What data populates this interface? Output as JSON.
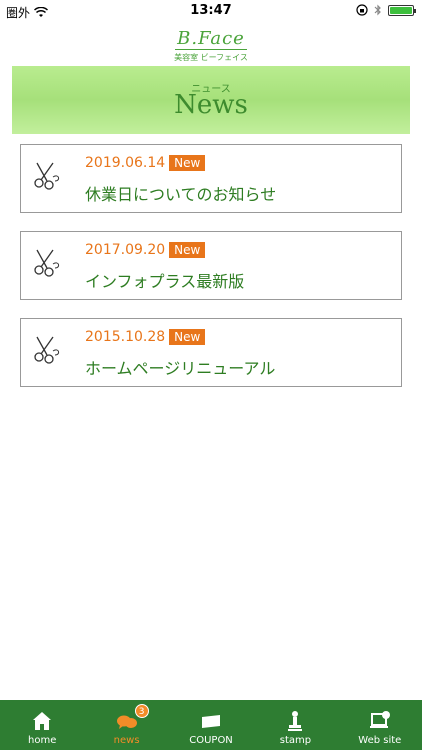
{
  "status_bar": {
    "carrier": "圏外",
    "time": "13:47",
    "battery_icon": "battery-full-icon",
    "wifi_icon": "wifi-icon",
    "bluetooth_icon": "bluetooth-icon",
    "lock_icon": "orientation-lock-icon"
  },
  "header": {
    "logo_text": "B.Face",
    "logo_sub": "美容室 ビーフェイス"
  },
  "banner": {
    "subtitle": "ニュース",
    "title": "News"
  },
  "news": [
    {
      "date": "2019.06.14",
      "badge": "New",
      "title": "休業日についてのお知らせ",
      "icon": "scissors-icon"
    },
    {
      "date": "2017.09.20",
      "badge": "New",
      "title": "インフォプラス最新版",
      "icon": "scissors-icon"
    },
    {
      "date": "2015.10.28",
      "badge": "New",
      "title": "ホームページリニューアル",
      "icon": "scissors-icon"
    }
  ],
  "tabs": [
    {
      "label": "home",
      "icon": "home-icon",
      "active": false
    },
    {
      "label": "news",
      "icon": "chat-bubbles-icon",
      "active": true,
      "badge": "3"
    },
    {
      "label": "COUPON",
      "icon": "coupon-ticket-icon",
      "active": false
    },
    {
      "label": "stamp",
      "icon": "stamp-icon",
      "active": false
    },
    {
      "label": "Web site",
      "icon": "web-browser-icon",
      "active": false
    }
  ],
  "colors": {
    "accent_green": "#2e7d32",
    "active_tab": "#f28c28",
    "date_orange": "#e8751a",
    "title_green": "#2e7d22"
  }
}
